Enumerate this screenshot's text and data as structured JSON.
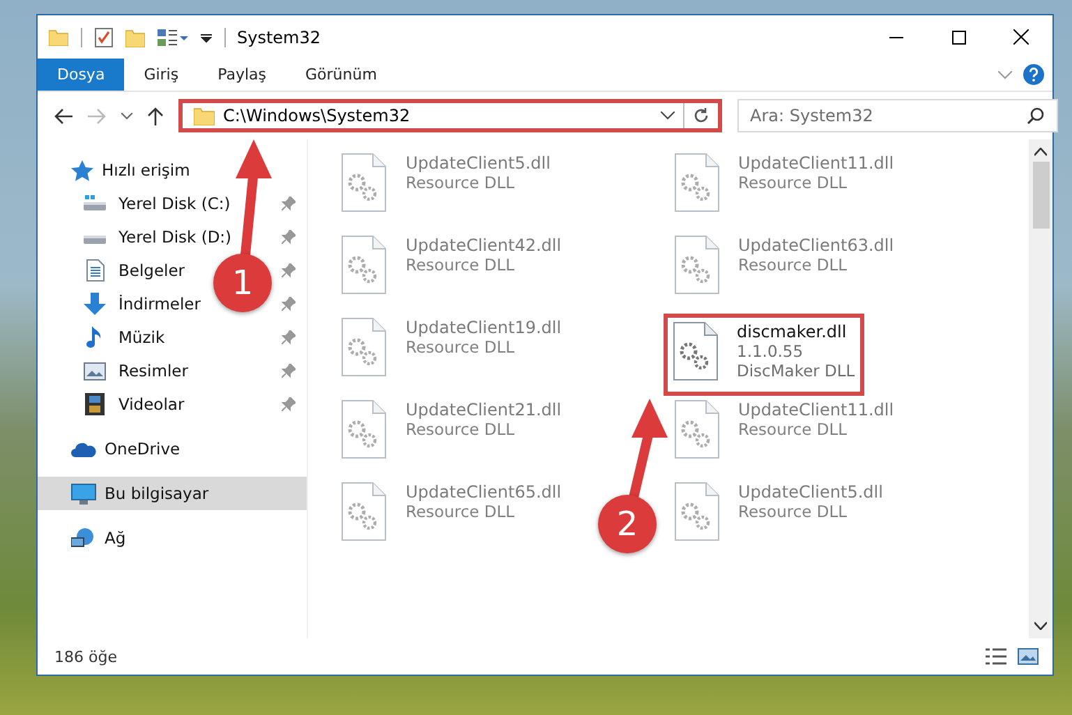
{
  "window": {
    "title": "System32"
  },
  "ribbon_tabs": [
    {
      "label": "Dosya",
      "kind": "file"
    },
    {
      "label": "Giriş",
      "kind": "tab"
    },
    {
      "label": "Paylaş",
      "kind": "tab"
    },
    {
      "label": "Görünüm",
      "kind": "tab"
    }
  ],
  "address_bar": {
    "path": "C:\\Windows\\System32",
    "highlighted": true
  },
  "search": {
    "placeholder": "Ara: System32"
  },
  "sidebar": {
    "items": [
      {
        "label": "Hızlı erişim",
        "kind": "star",
        "selected": false,
        "children": [
          {
            "label": "Yerel Disk (C:)",
            "kind": "drive-c",
            "pinned": true
          },
          {
            "label": "Yerel Disk (D:)",
            "kind": "drive",
            "pinned": true
          },
          {
            "label": "Belgeler",
            "kind": "documents",
            "pinned": true
          },
          {
            "label": "İndirmeler",
            "kind": "downloads",
            "pinned": true
          },
          {
            "label": "Müzik",
            "kind": "music",
            "pinned": true
          },
          {
            "label": "Resimler",
            "kind": "pictures",
            "pinned": true
          },
          {
            "label": "Videolar",
            "kind": "videos",
            "pinned": true
          }
        ]
      },
      {
        "label": "OneDrive",
        "kind": "cloud",
        "selected": false
      },
      {
        "label": "Bu bilgisayar",
        "kind": "computer",
        "selected": true
      },
      {
        "label": "Ağ",
        "kind": "network",
        "selected": false
      }
    ]
  },
  "files": [
    {
      "name": "UpdateClient5.dll",
      "lines": [
        "Resource DLL"
      ],
      "blurred": true,
      "highlighted": false
    },
    {
      "name": "UpdateClient11.dll",
      "lines": [
        "Resource DLL"
      ],
      "blurred": true,
      "highlighted": false
    },
    {
      "name": "UpdateClient42.dll",
      "lines": [
        "Resource DLL"
      ],
      "blurred": true,
      "highlighted": false
    },
    {
      "name": "UpdateClient63.dll",
      "lines": [
        "Resource DLL"
      ],
      "blurred": true,
      "highlighted": false
    },
    {
      "name": "UpdateClient19.dll",
      "lines": [
        "Resource DLL"
      ],
      "blurred": true,
      "highlighted": false
    },
    {
      "name": "discmaker.dll",
      "lines": [
        "1.1.0.55",
        "DiscMaker DLL"
      ],
      "blurred": false,
      "highlighted": true
    },
    {
      "name": "UpdateClient21.dll",
      "lines": [
        "Resource DLL"
      ],
      "blurred": true,
      "highlighted": false
    },
    {
      "name": "UpdateClient11.dll",
      "lines": [
        "Resource DLL"
      ],
      "blurred": true,
      "highlighted": false
    },
    {
      "name": "UpdateClient65.dll",
      "lines": [
        "Resource DLL"
      ],
      "blurred": true,
      "highlighted": false
    },
    {
      "name": "UpdateClient5.dll",
      "lines": [
        "Resource DLL"
      ],
      "blurred": true,
      "highlighted": false
    }
  ],
  "status_bar": {
    "item_count": "186 öğe"
  },
  "annotations": [
    {
      "label": "1"
    },
    {
      "label": "2"
    }
  ]
}
